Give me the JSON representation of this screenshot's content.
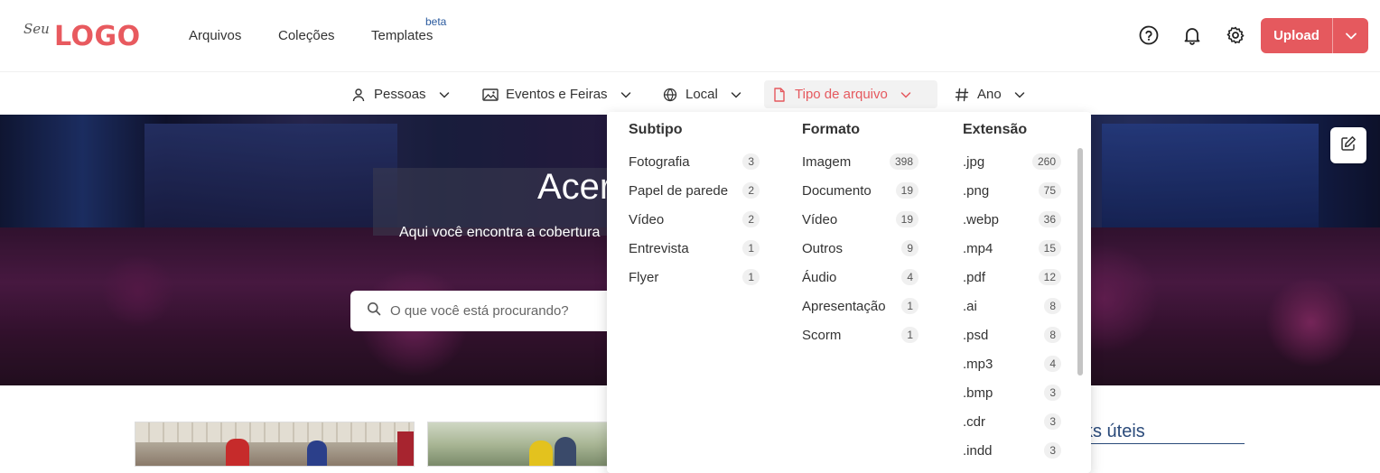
{
  "brand": {
    "script": "Seu",
    "word": "LOGO"
  },
  "nav": {
    "items": [
      {
        "label": "Arquivos"
      },
      {
        "label": "Coleções"
      },
      {
        "label": "Templates",
        "badge": "beta"
      }
    ]
  },
  "header_icons": [
    "help-icon",
    "bell-icon",
    "gear-icon"
  ],
  "upload": {
    "label": "Upload"
  },
  "filters": [
    {
      "label": "Pessoas",
      "icon": "person-icon"
    },
    {
      "label": "Eventos e Feiras",
      "icon": "image-icon"
    },
    {
      "label": "Local",
      "icon": "globe-icon"
    },
    {
      "label": "Tipo de arquivo",
      "icon": "file-icon",
      "active": true
    },
    {
      "label": "Ano",
      "icon": "hash-icon"
    }
  ],
  "hero": {
    "title": "Acer",
    "subtitle": "Aqui você encontra a cobertura",
    "search_placeholder": "O que você está procurando?"
  },
  "dropdown": {
    "columns": [
      {
        "title": "Subtipo",
        "options": [
          {
            "label": "Fotografia",
            "count": "3"
          },
          {
            "label": "Papel de parede",
            "count": "2"
          },
          {
            "label": "Vídeo",
            "count": "2"
          },
          {
            "label": "Entrevista",
            "count": "1"
          },
          {
            "label": "Flyer",
            "count": "1"
          }
        ]
      },
      {
        "title": "Formato",
        "options": [
          {
            "label": "Imagem",
            "count": "398"
          },
          {
            "label": "Documento",
            "count": "19"
          },
          {
            "label": "Vídeo",
            "count": "19"
          },
          {
            "label": "Outros",
            "count": "9"
          },
          {
            "label": "Áudio",
            "count": "4"
          },
          {
            "label": "Apresentação",
            "count": "1"
          },
          {
            "label": "Scorm",
            "count": "1"
          }
        ]
      },
      {
        "title": "Extensão",
        "options": [
          {
            "label": ".jpg",
            "count": "260"
          },
          {
            "label": ".png",
            "count": "75"
          },
          {
            "label": ".webp",
            "count": "36"
          },
          {
            "label": ".mp4",
            "count": "15"
          },
          {
            "label": ".pdf",
            "count": "12"
          },
          {
            "label": ".ai",
            "count": "8"
          },
          {
            "label": ".psd",
            "count": "8"
          },
          {
            "label": ".mp3",
            "count": "4"
          },
          {
            "label": ".bmp",
            "count": "3"
          },
          {
            "label": ".cdr",
            "count": "3"
          },
          {
            "label": ".indd",
            "count": "3"
          }
        ]
      }
    ]
  },
  "sidebar": {
    "links_title": "ks úteis"
  },
  "colors": {
    "accent": "#e5595e",
    "link": "#2a4a7a"
  }
}
